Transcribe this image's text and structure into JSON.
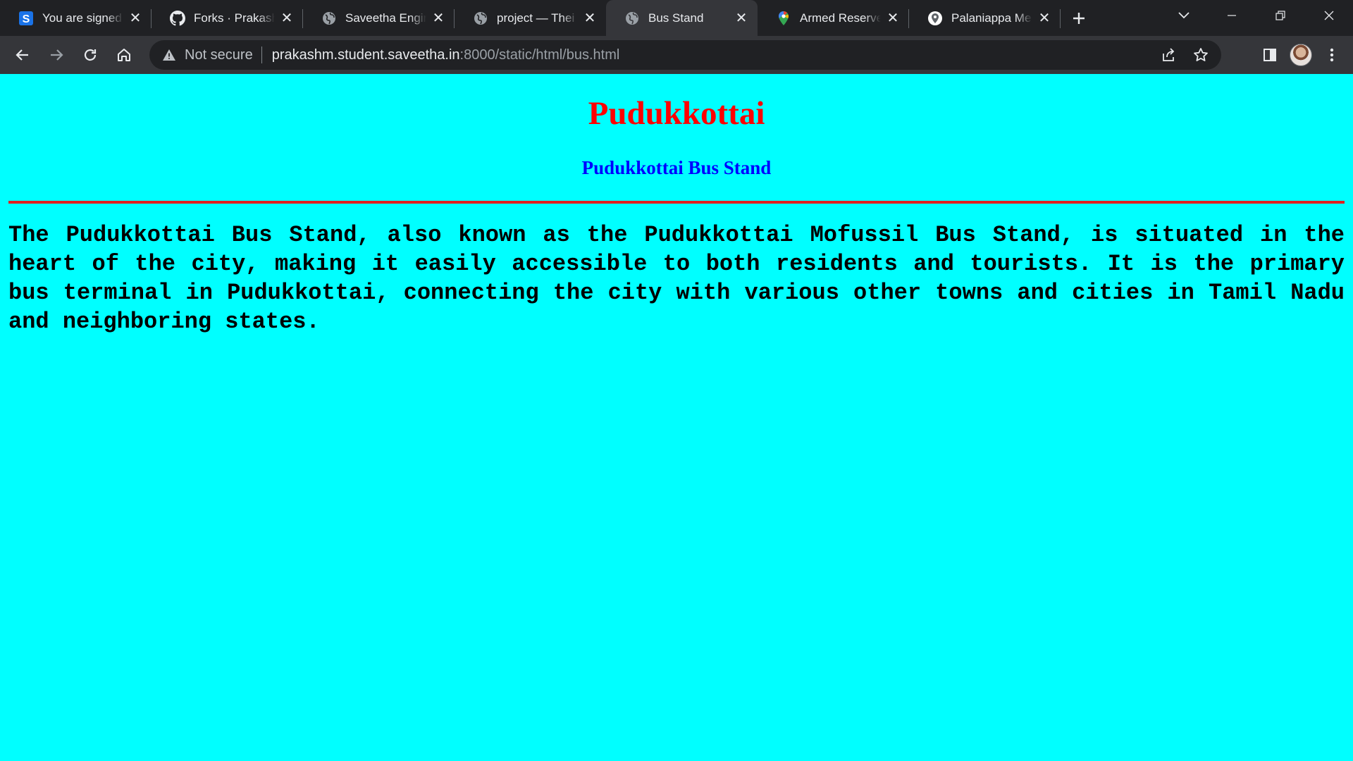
{
  "browser": {
    "tabs": [
      {
        "title": "You are signed",
        "favicon": "s-logo-icon",
        "active": false
      },
      {
        "title": "Forks · Prakash",
        "favicon": "github-icon",
        "active": false
      },
      {
        "title": "Saveetha Engir",
        "favicon": "globe-icon",
        "active": false
      },
      {
        "title": "project — Thei",
        "favicon": "globe-icon",
        "active": false
      },
      {
        "title": "Bus Stand",
        "favicon": "globe-icon",
        "active": true
      },
      {
        "title": "Armed Reserve",
        "favicon": "maps-pin-icon",
        "active": false
      },
      {
        "title": "Palaniappa Me",
        "favicon": "place-pin-icon",
        "active": false
      }
    ],
    "security_label": "Not secure",
    "url_host": "prakashm.student.saveetha.in",
    "url_rest": ":8000/static/html/bus.html"
  },
  "page": {
    "heading": "Pudukkottai",
    "subheading": "Pudukkottai Bus Stand",
    "body": "The Pudukkottai Bus Stand, also known as the Pudukkottai Mofussil Bus Stand, is situated in the heart of the city, making it easily accessible to both residents and tourists. It is the primary bus terminal in Pudukkottai, connecting the city with various other towns and cities in Tamil Nadu and neighboring states.",
    "background_color": "#00ffff",
    "heading_color": "#ff0000",
    "subheading_color": "#0000ff",
    "rule_color": "#e02020"
  }
}
